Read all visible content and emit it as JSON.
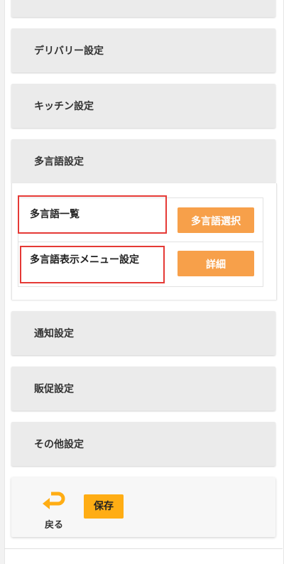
{
  "settings_sections": {
    "top_partial_label": "",
    "delivery": "デリバリー設定",
    "kitchen": "キッチン設定",
    "multilang": "多言語設定",
    "notification": "通知設定",
    "promotion": "販促設定",
    "other": "その他設定"
  },
  "multilang_panel": {
    "rows": [
      {
        "label": "多言語一覧",
        "button_label": "多言語選択"
      },
      {
        "label": "多言語表示メニュー設定",
        "button_label": "詳細"
      }
    ]
  },
  "footer": {
    "back_label": "戻る",
    "save_label": "保存"
  },
  "colors": {
    "accent_orange": "#f7a04a",
    "save_yellow": "#ffad14",
    "highlight_red": "#e53935",
    "back_icon": "#ffad14"
  },
  "icons": {
    "back": "return-arrow-icon"
  }
}
